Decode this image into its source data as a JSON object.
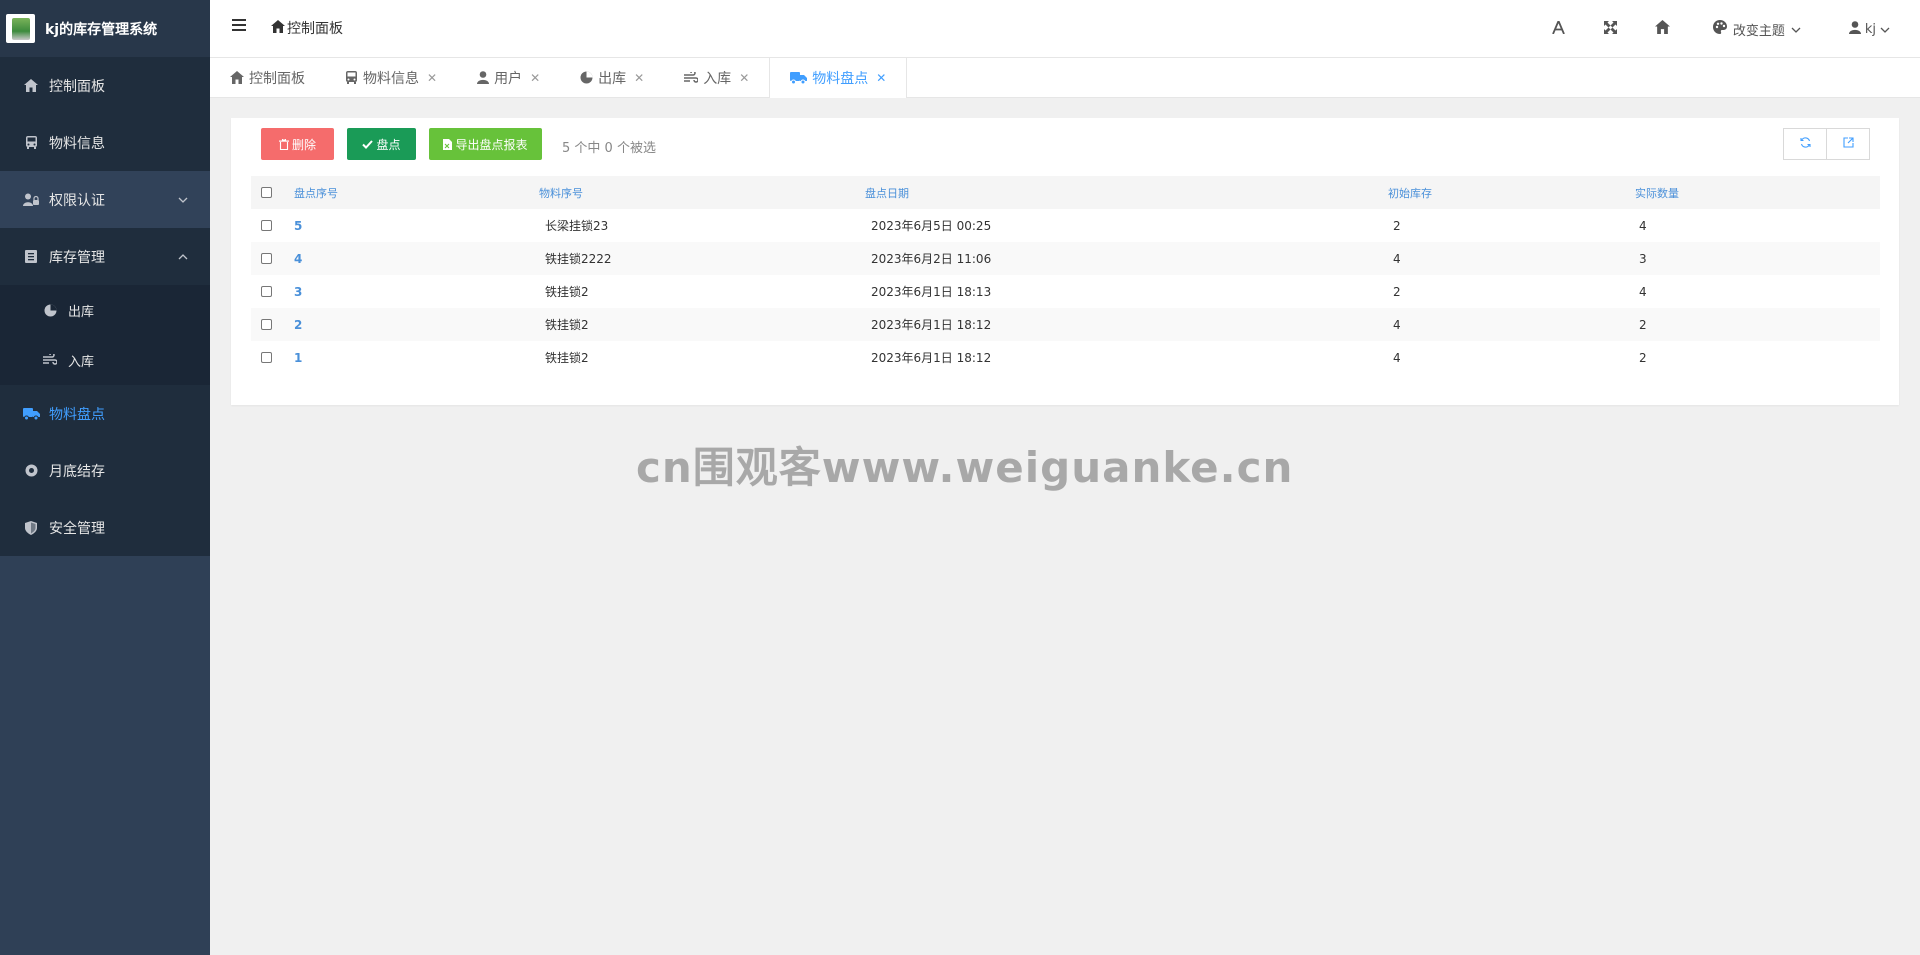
{
  "app": {
    "title": "kj的库存管理系统"
  },
  "sidebar": {
    "items": [
      {
        "label": "控制面板",
        "icon": "home-icon"
      },
      {
        "label": "物料信息",
        "icon": "bus-icon"
      },
      {
        "label": "权限认证",
        "icon": "user-lock-icon"
      },
      {
        "label": "库存管理",
        "icon": "list-icon"
      },
      {
        "label": "出库",
        "icon": "chart-pie-icon"
      },
      {
        "label": "入库",
        "icon": "wind-icon"
      },
      {
        "label": "物料盘点",
        "icon": "truck-icon"
      },
      {
        "label": "月底结存",
        "icon": "dot-circle-icon"
      },
      {
        "label": "安全管理",
        "icon": "shield-icon"
      }
    ]
  },
  "header": {
    "breadcrumb": "控制面板",
    "theme_label": "改变主题",
    "user_label": "kj"
  },
  "tabs": [
    {
      "label": "控制面板"
    },
    {
      "label": "物料信息"
    },
    {
      "label": "用户"
    },
    {
      "label": "出库"
    },
    {
      "label": "入库"
    },
    {
      "label": "物料盘点"
    }
  ],
  "toolbar": {
    "delete_label": "删除",
    "check_label": "盘点",
    "export_label": "导出盘点报表",
    "selection_info": "5 个中 0 个被选"
  },
  "table": {
    "headers": [
      "盘点序号",
      "物料序号",
      "盘点日期",
      "初始库存",
      "实际数量"
    ],
    "rows": [
      {
        "id": "5",
        "material": "长梁挂锁23",
        "date": "2023年6月5日 00:25",
        "initial": "2",
        "actual": "4"
      },
      {
        "id": "4",
        "material": "铁挂锁2222",
        "date": "2023年6月2日 11:06",
        "initial": "4",
        "actual": "3"
      },
      {
        "id": "3",
        "material": "铁挂锁2",
        "date": "2023年6月1日 18:13",
        "initial": "2",
        "actual": "4"
      },
      {
        "id": "2",
        "material": "铁挂锁2",
        "date": "2023年6月1日 18:12",
        "initial": "4",
        "actual": "2"
      },
      {
        "id": "1",
        "material": "铁挂锁2",
        "date": "2023年6月1日 18:12",
        "initial": "4",
        "actual": "2"
      }
    ]
  },
  "watermark": "cn围观客www.weiguanke.cn",
  "colors": {
    "sidebar_bg": "#2f4056",
    "active_blue": "#409eff",
    "delete_red": "#f56c6c",
    "check_green": "#1a9b57",
    "export_green": "#67c23a"
  }
}
